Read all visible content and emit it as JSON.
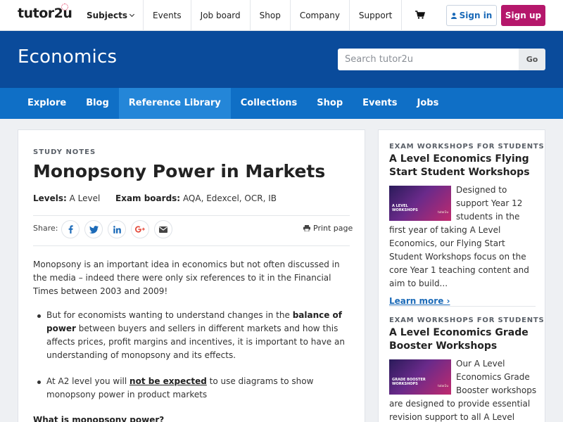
{
  "header": {
    "logo": "tutor2u",
    "nav": [
      "Subjects",
      "Events",
      "Job board",
      "Shop",
      "Company",
      "Support"
    ],
    "sign_in": "Sign in",
    "sign_up": "Sign up"
  },
  "hero": {
    "title": "Economics",
    "search_placeholder": "Search tutor2u",
    "go": "Go"
  },
  "subnav": [
    "Explore",
    "Blog",
    "Reference Library",
    "Collections",
    "Shop",
    "Events",
    "Jobs"
  ],
  "article": {
    "kicker": "STUDY NOTES",
    "title": "Monopsony Power in Markets",
    "levels_label": "Levels:",
    "levels_value": "A Level",
    "exam_label": "Exam boards:",
    "exam_value": "AQA, Edexcel, OCR, IB",
    "share_label": "Share:",
    "print": "Print page",
    "intro": "Monopsony is an important idea in economics but not often discussed in the media – indeed there were only six references to it in the Financial Times between 2003 and 2009!",
    "bullet1_a": "But for economists wanting to understand changes in the ",
    "bullet1_b": "balance of power",
    "bullet1_c": " between buyers and sellers in different markets and how this affects prices, profit margins and incentives, it is important to have an understanding of monopsony and its effects.",
    "bullet2_a": "At A2 level you will ",
    "bullet2_b": "not be expected",
    "bullet2_c": " to use diagrams to show monopsony power in product markets",
    "subheading": "What is monopsony power?"
  },
  "sidebar": {
    "card1": {
      "kicker": "EXAM WORKSHOPS FOR STUDENTS",
      "title": "A Level Economics Flying Start Student Workshops",
      "body": "Designed to support Year 12 students in the first year of taking A Level Economics, our Flying Start Student Workshops focus on the core Year 1 teaching content and aim to build...",
      "link": "Learn more ›"
    },
    "card2": {
      "kicker": "EXAM WORKSHOPS FOR STUDENTS",
      "title": "A Level Economics Grade Booster Workshops",
      "body": "Our A Level Economics Grade Booster workshops are designed to provide essential revision support to all A Level"
    }
  },
  "colors": {
    "hero": "#0a4b9b",
    "subnav": "#0f6fc6",
    "signup": "#b5176b",
    "link": "#1b6ab8"
  }
}
